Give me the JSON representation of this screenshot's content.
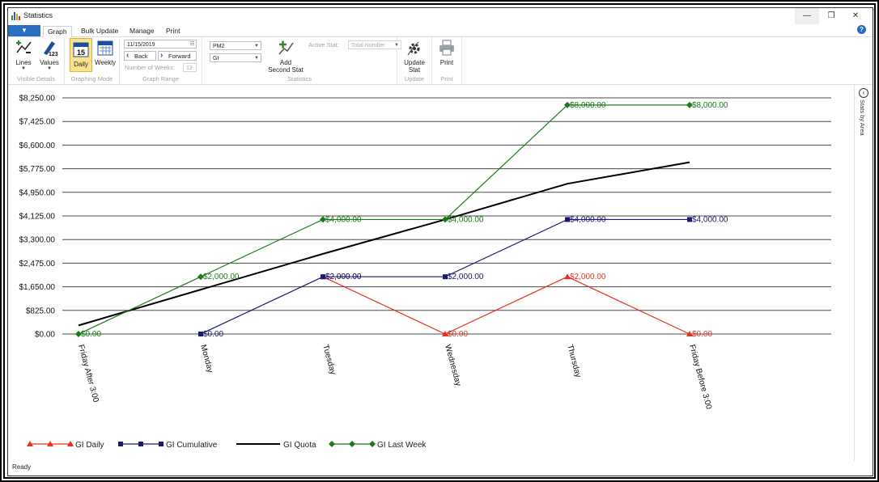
{
  "window": {
    "title": "Statistics"
  },
  "tabs": [
    "Graph",
    "Bulk Update",
    "Manage",
    "Print"
  ],
  "ribbon": {
    "visible_details": {
      "lines_label": "Lines",
      "values_label": "Values",
      "group_label": "Visible Details"
    },
    "graphing_mode": {
      "daily_label": "Daily",
      "weekly_label": "Weekly",
      "group_label": "Graphing Mode",
      "daily_icon_text": "15"
    },
    "graph_range": {
      "date": "11/15/2019",
      "back_label": "Back",
      "forward_label": "Forward",
      "weeks_label": "Number of Weeks:",
      "weeks_value": "12",
      "group_label": "Graph Range"
    },
    "statistics": {
      "stat1": "PM2",
      "stat2": "GI",
      "add_label_1": "Add",
      "add_label_2": "Second Stat",
      "active_stat_label": "Active Stat:",
      "active_stat_value": "Total Number",
      "group_label": "Statistics"
    },
    "update": {
      "label_1": "Update",
      "label_2": "Stat",
      "group_label": "Update"
    },
    "print": {
      "label": "Print",
      "group_label": "Print"
    }
  },
  "side_panel": {
    "label": "Stats by Area"
  },
  "status": "Ready",
  "colors": {
    "daily": "#e8311f",
    "cumulative": "#191970",
    "quota": "#000000",
    "lastweek": "#1a7a1a"
  },
  "chart_data": {
    "type": "line",
    "categories": [
      "Friday After 3:00",
      "Monday",
      "Tuesday",
      "Wednesday",
      "Thursday",
      "Friday Before 3:00"
    ],
    "ylim": [
      0,
      8250
    ],
    "yticks": [
      "$0.00",
      "$825.00",
      "$1,650.00",
      "$2,475.00",
      "$3,300.00",
      "$4,125.00",
      "$4,950.00",
      "$5,775.00",
      "$6,600.00",
      "$7,425.00",
      "$8,250.00"
    ],
    "series": [
      {
        "name": "GI Daily",
        "marker": "triangle",
        "color": "#e8311f",
        "values": [
          null,
          null,
          2000,
          0,
          2000,
          0
        ],
        "labels": [
          null,
          null,
          "$2,000.00",
          "$0.00",
          "$2,000.00",
          "$0.00"
        ]
      },
      {
        "name": "GI Cumulative",
        "marker": "square",
        "color": "#191970",
        "values": [
          null,
          0,
          2000,
          2000,
          4000,
          4000
        ],
        "labels": [
          null,
          "$0.00",
          "$2,000.00",
          "$2,000.00",
          "$4,000.00",
          "$4,000.00"
        ]
      },
      {
        "name": "GI Quota",
        "marker": "none",
        "color": "#000000",
        "values": [
          300,
          1550,
          2800,
          4000,
          5250,
          6000
        ],
        "labels": [
          null,
          null,
          null,
          null,
          null,
          null
        ]
      },
      {
        "name": "GI Last Week",
        "marker": "diamond",
        "color": "#1a7a1a",
        "values": [
          0,
          2000,
          4000,
          4000,
          8000,
          8000
        ],
        "labels": [
          "$0.00",
          "$2,000.00",
          "$4,000.00",
          "$4,000.00",
          "$8,000.00",
          "$8,000.00"
        ]
      }
    ]
  }
}
